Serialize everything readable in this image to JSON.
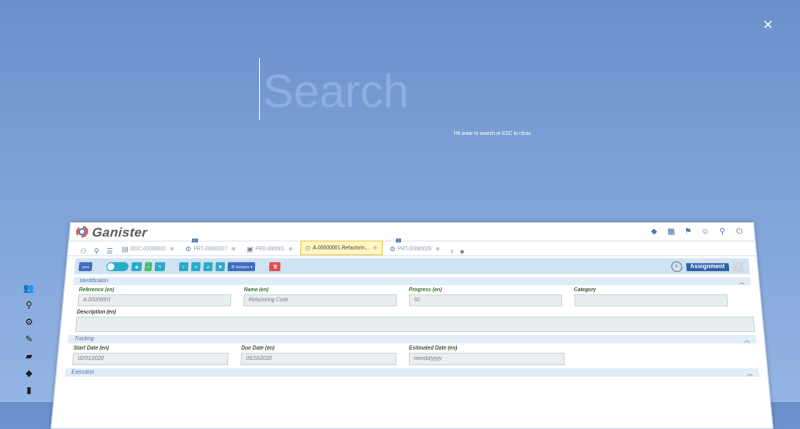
{
  "overlay": {
    "close_label": "×",
    "search_placeholder": "Search",
    "hint": "Hit enter to search or ESC to close"
  },
  "app": {
    "brand": "Ganister",
    "header_icons": [
      "cube-icon",
      "grid-icon",
      "flag-icon",
      "user-icon",
      "search-icon",
      "power-icon"
    ],
    "nav_icons": [
      "users-icon",
      "search-icon",
      "menu-icon"
    ],
    "tabs": [
      {
        "label": "DOC-00000002",
        "active": false,
        "icon": "document-icon",
        "badge": ""
      },
      {
        "label": "PRT-00000027",
        "active": false,
        "icon": "part-icon",
        "badge": "1"
      },
      {
        "label": "PRD-000001",
        "active": false,
        "icon": "product-icon",
        "badge": ""
      },
      {
        "label": "A-00000001-Refactorin...",
        "active": true,
        "icon": "assignment-icon",
        "badge": ""
      },
      {
        "label": "PRT-00000026",
        "active": false,
        "icon": "part-icon",
        "badge": "1"
      }
    ],
    "toolbar": {
      "new_label": "new",
      "actions_label": "Actions",
      "assignment_label": "Assignment"
    },
    "identification": {
      "title": "Identification",
      "fields": [
        {
          "label": "Reference (en)",
          "value": "A-00000001",
          "green": true
        },
        {
          "label": "Name (en)",
          "value": "Refactoring Code",
          "green": true
        },
        {
          "label": "Progress (en)",
          "value": "50",
          "green": true
        },
        {
          "label": "Category",
          "value": "",
          "green": false
        }
      ],
      "description_label": "Description (en)"
    },
    "tracking": {
      "title": "Tracking",
      "fields": [
        {
          "label": "Start Date (en)",
          "value": "02/01/2020"
        },
        {
          "label": "Due Date (en)",
          "value": "05/10/2020"
        },
        {
          "label": "Estimated Date (en)",
          "value": "mm/dd/yyyy"
        }
      ]
    },
    "execution": {
      "title": "Execution"
    },
    "left_icons": [
      "users-icon",
      "search-icon",
      "settings-icon",
      "edit-icon",
      "folder-icon",
      "chart-icon",
      "tag-icon",
      "book-icon"
    ]
  },
  "colors": {
    "background": "#7ca0d6",
    "primary_blue": "#3e6cbc",
    "teal": "#2aa9c8",
    "green": "#4cbb6b",
    "red": "#e24b4b"
  }
}
